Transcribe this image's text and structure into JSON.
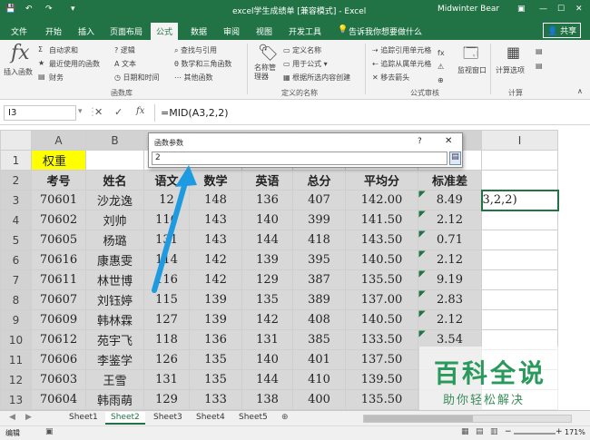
{
  "title_bar": {
    "title": "excel学生成绩单 [兼容模式] - Excel",
    "user": "Midwinter Bear"
  },
  "menu": {
    "items": [
      "文件",
      "开始",
      "插入",
      "页面布局",
      "公式",
      "数据",
      "审阅",
      "视图",
      "开发工具"
    ],
    "active": "公式",
    "tell_me": "告诉我你想要做什么",
    "share": "共享"
  },
  "ribbon": {
    "insert_function": "插入函数",
    "autosum": "自动求和",
    "recent": "最近使用的函数",
    "financial": "财务",
    "logical": "逻辑",
    "text": "文本",
    "datetime": "日期和时间",
    "lookup": "查找与引用",
    "math": "数学和三角函数",
    "more": "其他函数",
    "library_group": "函数库",
    "name_manager": "名称管理器",
    "define_name": "定义名称",
    "use_in_formula": "用于公式",
    "create_from_selection": "根据所选内容创建",
    "names_group": "定义的名称",
    "trace_precedents": "追踪引用单元格",
    "trace_dependents": "追踪从属单元格",
    "remove_arrows": "移去箭头",
    "audit_group": "公式审核",
    "watch_window": "监视窗口",
    "calc_options": "计算选项",
    "calc_group": "计算"
  },
  "formula_bar": {
    "name_box": "I3",
    "formula": "=MID(A3,2,2)"
  },
  "columns": [
    "A",
    "B",
    "C",
    "D",
    "E",
    "F",
    "G",
    "H",
    "I"
  ],
  "rows": [
    {
      "n": "1",
      "cells": [
        "权重",
        "",
        "",
        "",
        "",
        "",
        "",
        "分",
        ""
      ]
    },
    {
      "n": "2",
      "cells": [
        "考号",
        "姓名",
        "语文",
        "数学",
        "英语",
        "总分",
        "平均分",
        "标准差",
        ""
      ]
    },
    {
      "n": "3",
      "cells": [
        "70601",
        "沙龙逸",
        "12",
        "148",
        "136",
        "407",
        "142.00",
        "8.49",
        "3,2,2)"
      ]
    },
    {
      "n": "4",
      "cells": [
        "70602",
        "刘帅",
        "116",
        "143",
        "140",
        "399",
        "141.50",
        "2.12",
        ""
      ]
    },
    {
      "n": "5",
      "cells": [
        "70605",
        "杨璐",
        "131",
        "143",
        "144",
        "418",
        "143.50",
        "0.71",
        ""
      ]
    },
    {
      "n": "6",
      "cells": [
        "70616",
        "康惠雯",
        "114",
        "142",
        "139",
        "395",
        "140.50",
        "2.12",
        ""
      ]
    },
    {
      "n": "7",
      "cells": [
        "70611",
        "林世博",
        "116",
        "142",
        "129",
        "387",
        "135.50",
        "9.19",
        ""
      ]
    },
    {
      "n": "8",
      "cells": [
        "70607",
        "刘钰婷",
        "115",
        "139",
        "135",
        "389",
        "137.00",
        "2.83",
        ""
      ]
    },
    {
      "n": "9",
      "cells": [
        "70609",
        "韩林霖",
        "127",
        "139",
        "142",
        "408",
        "140.50",
        "2.12",
        ""
      ]
    },
    {
      "n": "10",
      "cells": [
        "70612",
        "苑宇飞",
        "118",
        "136",
        "131",
        "385",
        "133.50",
        "3.54",
        ""
      ]
    },
    {
      "n": "11",
      "cells": [
        "70606",
        "李鉴学",
        "126",
        "135",
        "140",
        "401",
        "137.50",
        "",
        ""
      ]
    },
    {
      "n": "12",
      "cells": [
        "70603",
        "王雪",
        "131",
        "135",
        "144",
        "410",
        "139.50",
        "",
        ""
      ]
    },
    {
      "n": "13",
      "cells": [
        "70604",
        "韩雨萌",
        "129",
        "133",
        "138",
        "400",
        "135.50",
        "",
        ""
      ]
    }
  ],
  "dialog": {
    "title": "函数参数",
    "help": "?",
    "close": "✕",
    "input_value": "2"
  },
  "sheets": {
    "tabs": [
      "Sheet1",
      "Sheet2",
      "Sheet3",
      "Sheet4",
      "Sheet5"
    ],
    "active": "Sheet2"
  },
  "status": {
    "mode": "编辑",
    "zoom": "171%"
  },
  "watermark": {
    "main": "百科全说",
    "sub": "助你轻松解决"
  },
  "colors": {
    "excel_green": "#217346",
    "weight_yellow": "#ffff00",
    "arrow_blue": "#1e9be0"
  }
}
